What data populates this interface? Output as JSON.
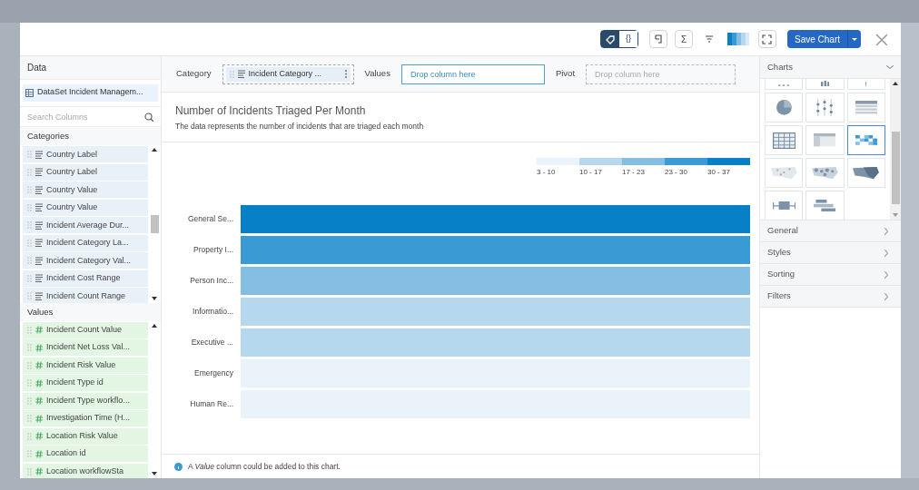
{
  "toolbar": {
    "view_toggle": [
      {
        "kind": "tag",
        "selected": true
      },
      {
        "kind": "code",
        "label": "{}",
        "selected": false
      }
    ],
    "tools": [
      {
        "kind": "doc"
      },
      {
        "kind": "sum",
        "label": "Σ"
      },
      {
        "kind": "lines"
      },
      {
        "kind": "palette"
      },
      {
        "kind": "expand"
      }
    ],
    "save_button": "Save Chart"
  },
  "data_panel": {
    "title": "Data",
    "dataset": "DataSet Incident Managem...",
    "search": {
      "placeholder": "Search Columns"
    },
    "categories": {
      "title": "Categories",
      "items": [
        "Country Label",
        "Country Label",
        "Country Value",
        "Country Value",
        "Incident Average Dur...",
        "Incident Category La...",
        "Incident Category Val...",
        "Incident Cost Range",
        "Incident Count Range"
      ]
    },
    "values": {
      "title": "Values",
      "items": [
        "Incident Count Value",
        "Incident Net Loss Val...",
        "Incident Risk Value",
        "Incident Type id",
        "Incident Type workflo...",
        "Investigation Time (H...",
        "Location Risk Value",
        "Location id",
        "Location workflowSta"
      ]
    }
  },
  "drop_zones": [
    {
      "label": "Category",
      "kind": "chip",
      "value": "Incident Category ..."
    },
    {
      "label": "Values",
      "kind": "active",
      "placeholder": "Drop column here"
    },
    {
      "label": "Pivot",
      "kind": "empty",
      "placeholder": "Drop column here"
    }
  ],
  "chart": {
    "title": "Number of Incidents Triaged Per Month",
    "subtitle": "The data represents the number of incidents that are triaged each month",
    "legend": [
      {
        "label": "3 - 10",
        "color": "#eaf3fa"
      },
      {
        "label": "10 - 17",
        "color": "#b5d8ee"
      },
      {
        "label": "17 - 23",
        "color": "#84bfe3"
      },
      {
        "label": "23 - 30",
        "color": "#3a9ad3"
      },
      {
        "label": "30 - 37",
        "color": "#0880c8"
      }
    ],
    "rows": [
      {
        "label": "General Se...",
        "color": "#0880c8"
      },
      {
        "label": "Property I...",
        "color": "#3a9ad3"
      },
      {
        "label": "Person Inc...",
        "color": "#84bfe3"
      },
      {
        "label": "Informatio...",
        "color": "#b5d8ee"
      },
      {
        "label": "Executive ...",
        "color": "#b5d8ee"
      },
      {
        "label": "Emergency",
        "color": "#eaf3fa"
      },
      {
        "label": "Human Re...",
        "color": "#eaf3fa"
      }
    ],
    "note": "A *Value* column could be added to this chart."
  },
  "charts_panel": {
    "title": "Charts",
    "expanded": true,
    "types": [
      {
        "kind": "cut-dots",
        "selected": false
      },
      {
        "kind": "cut-bars",
        "selected": false
      },
      {
        "kind": "cut-line",
        "selected": false
      },
      {
        "kind": "pie",
        "selected": false
      },
      {
        "kind": "dots",
        "selected": false
      },
      {
        "kind": "table",
        "selected": false
      },
      {
        "kind": "grid",
        "selected": false
      },
      {
        "kind": "pivot",
        "selected": false
      },
      {
        "kind": "heatmap",
        "selected": true
      },
      {
        "kind": "map-dots",
        "selected": false
      },
      {
        "kind": "map-bubbles",
        "selected": false
      },
      {
        "kind": "map-filled",
        "selected": false
      },
      {
        "kind": "boxplot",
        "selected": false
      },
      {
        "kind": "gantt",
        "selected": false
      }
    ],
    "sections": [
      {
        "label": "General",
        "expanded": false
      },
      {
        "label": "Styles",
        "expanded": false
      },
      {
        "label": "Sorting",
        "expanded": false
      },
      {
        "label": "Filters",
        "expanded": false
      }
    ]
  }
}
